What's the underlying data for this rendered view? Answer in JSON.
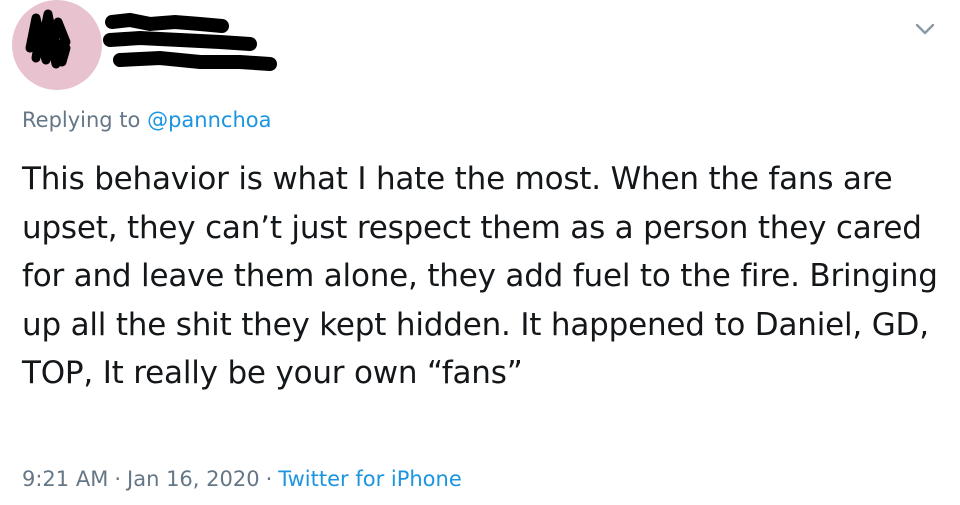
{
  "tweet": {
    "replying_prefix": "Replying to",
    "replying_handle": "@pannchoa",
    "text": "This behavior is what I hate the most. When the fans are upset, they can’t just respect them as a person they cared for and leave them alone, they add fuel to the fire. Bringing up all the shit they kept hidden. It happened to Daniel, GD, TOP, It really be your own “fans”",
    "time": "9:21 AM",
    "separator": "·",
    "date": "Jan 16, 2020",
    "source": "Twitter for iPhone"
  },
  "icons": {
    "avatar": "avatar-icon",
    "more": "chevron-down-icon"
  },
  "colors": {
    "text": "#14171a",
    "muted": "#657786",
    "link": "#1b95e0",
    "avatar_bg": "#e9c2cf",
    "redaction": "#000000"
  }
}
